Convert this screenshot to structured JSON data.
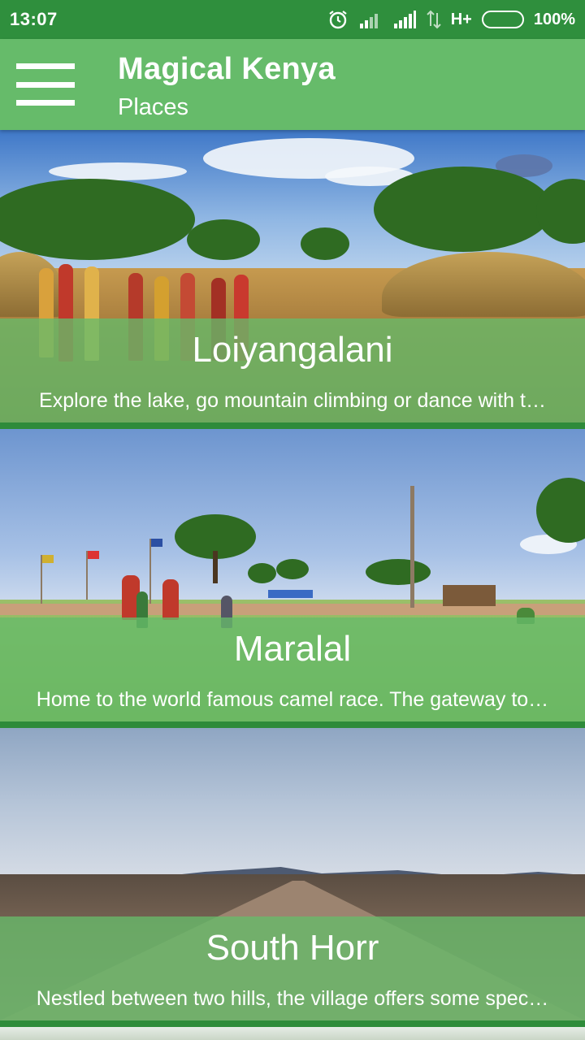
{
  "status_bar": {
    "time": "13:07",
    "network": "H+",
    "battery": "100%",
    "icons": [
      "alarm-icon",
      "signal-icon",
      "signal-icon",
      "data-transfer-icon",
      "battery-icon"
    ]
  },
  "app_bar": {
    "menu_icon": "hamburger-menu-icon",
    "title": "Magical Kenya",
    "subtitle": "Places"
  },
  "places": [
    {
      "name": "Loiyangalani",
      "description": "Explore the lake, go mountain climbing or dance with t…"
    },
    {
      "name": "Maralal",
      "description": "Home to the world famous camel race. The gateway to…"
    },
    {
      "name": "South Horr",
      "description": "Nestled between two hills, the village offers some spec…"
    }
  ],
  "colors": {
    "status_bar": "#2f8f3d",
    "app_bar": "#66bb6a",
    "overlay": "#66bb6a",
    "separator": "#2e8b3a"
  }
}
